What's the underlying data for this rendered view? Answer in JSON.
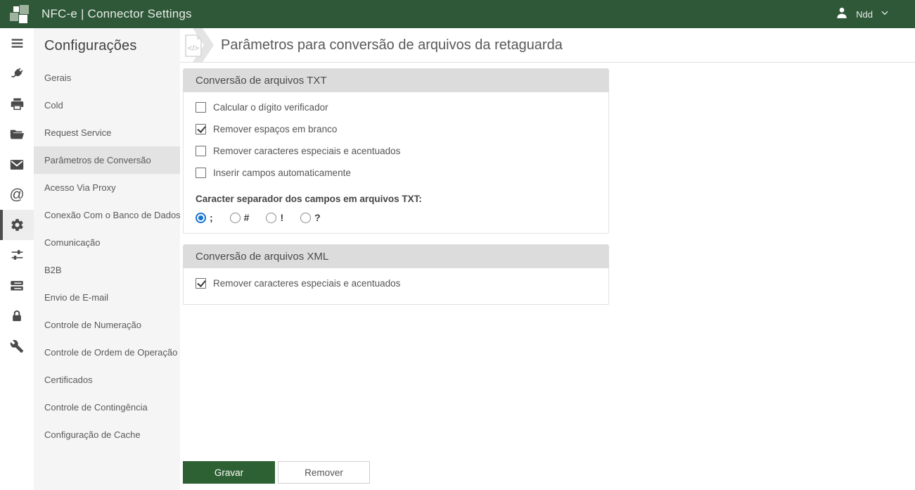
{
  "topbar": {
    "title": "NFC-e | Connector Settings",
    "user_name": "Ndd",
    "icons": {
      "logo": "grid-squares-logo",
      "user": "person-icon",
      "dropdown": "chevron-down-icon"
    }
  },
  "iconbar": {
    "items": [
      {
        "name": "menu-icon",
        "selected": false
      },
      {
        "name": "plug-icon",
        "selected": false
      },
      {
        "name": "printer-icon",
        "selected": false
      },
      {
        "name": "folder-open-icon",
        "selected": false
      },
      {
        "name": "mail-icon",
        "selected": false
      },
      {
        "name": "at-icon",
        "selected": false,
        "glyph": "@"
      },
      {
        "name": "gear-icon",
        "selected": true
      },
      {
        "name": "sliders-icon",
        "selected": false
      },
      {
        "name": "server-icon",
        "selected": false
      },
      {
        "name": "lock-icon",
        "selected": false
      },
      {
        "name": "wrench-icon",
        "selected": false
      }
    ]
  },
  "sidebar": {
    "title": "Configurações",
    "items": [
      {
        "label": "Gerais",
        "selected": false
      },
      {
        "label": "Cold",
        "selected": false
      },
      {
        "label": "Request Service",
        "selected": false
      },
      {
        "label": "Parâmetros de Conversão",
        "selected": true
      },
      {
        "label": "Acesso Via Proxy",
        "selected": false
      },
      {
        "label": "Conexão Com o Banco de Dados",
        "selected": false
      },
      {
        "label": "Comunicação",
        "selected": false
      },
      {
        "label": "B2B",
        "selected": false
      },
      {
        "label": "Envio de E-mail",
        "selected": false
      },
      {
        "label": "Controle de Numeração",
        "selected": false
      },
      {
        "label": "Controle de Ordem de Operação",
        "selected": false
      },
      {
        "label": "Certificados",
        "selected": false
      },
      {
        "label": "Controle de Contingência",
        "selected": false
      },
      {
        "label": "Configuração de Cache",
        "selected": false
      }
    ]
  },
  "main": {
    "title": "Parâmetros para conversão de arquivos da retaguarda",
    "header_icon": "code-file-icon",
    "sections": [
      {
        "title": "Conversão de arquivos TXT",
        "checkboxes": [
          {
            "label": "Calcular o dígito verificador",
            "checked": false
          },
          {
            "label": "Remover espaços em branco",
            "checked": true
          },
          {
            "label": "Remover caracteres especiais e acentuados",
            "checked": false
          },
          {
            "label": "Inserir campos automaticamente",
            "checked": false
          }
        ],
        "separator_label": "Caracter separador dos campos em arquivos TXT:",
        "separator_options": [
          {
            "label": ";",
            "selected": true
          },
          {
            "label": "#",
            "selected": false
          },
          {
            "label": "!",
            "selected": false
          },
          {
            "label": "?",
            "selected": false
          }
        ]
      },
      {
        "title": "Conversão de arquivos XML",
        "checkboxes": [
          {
            "label": "Remover caracteres especiais e acentuados",
            "checked": true
          }
        ]
      }
    ],
    "buttons": {
      "save": "Gravar",
      "remove": "Remover"
    }
  },
  "colors": {
    "topbar_green": "#2f5839",
    "button_green": "#2d6133",
    "radio_blue": "#1673d1",
    "panel_header_gray": "#dcdcdc",
    "sidebar_gray": "#f5f5f5"
  }
}
